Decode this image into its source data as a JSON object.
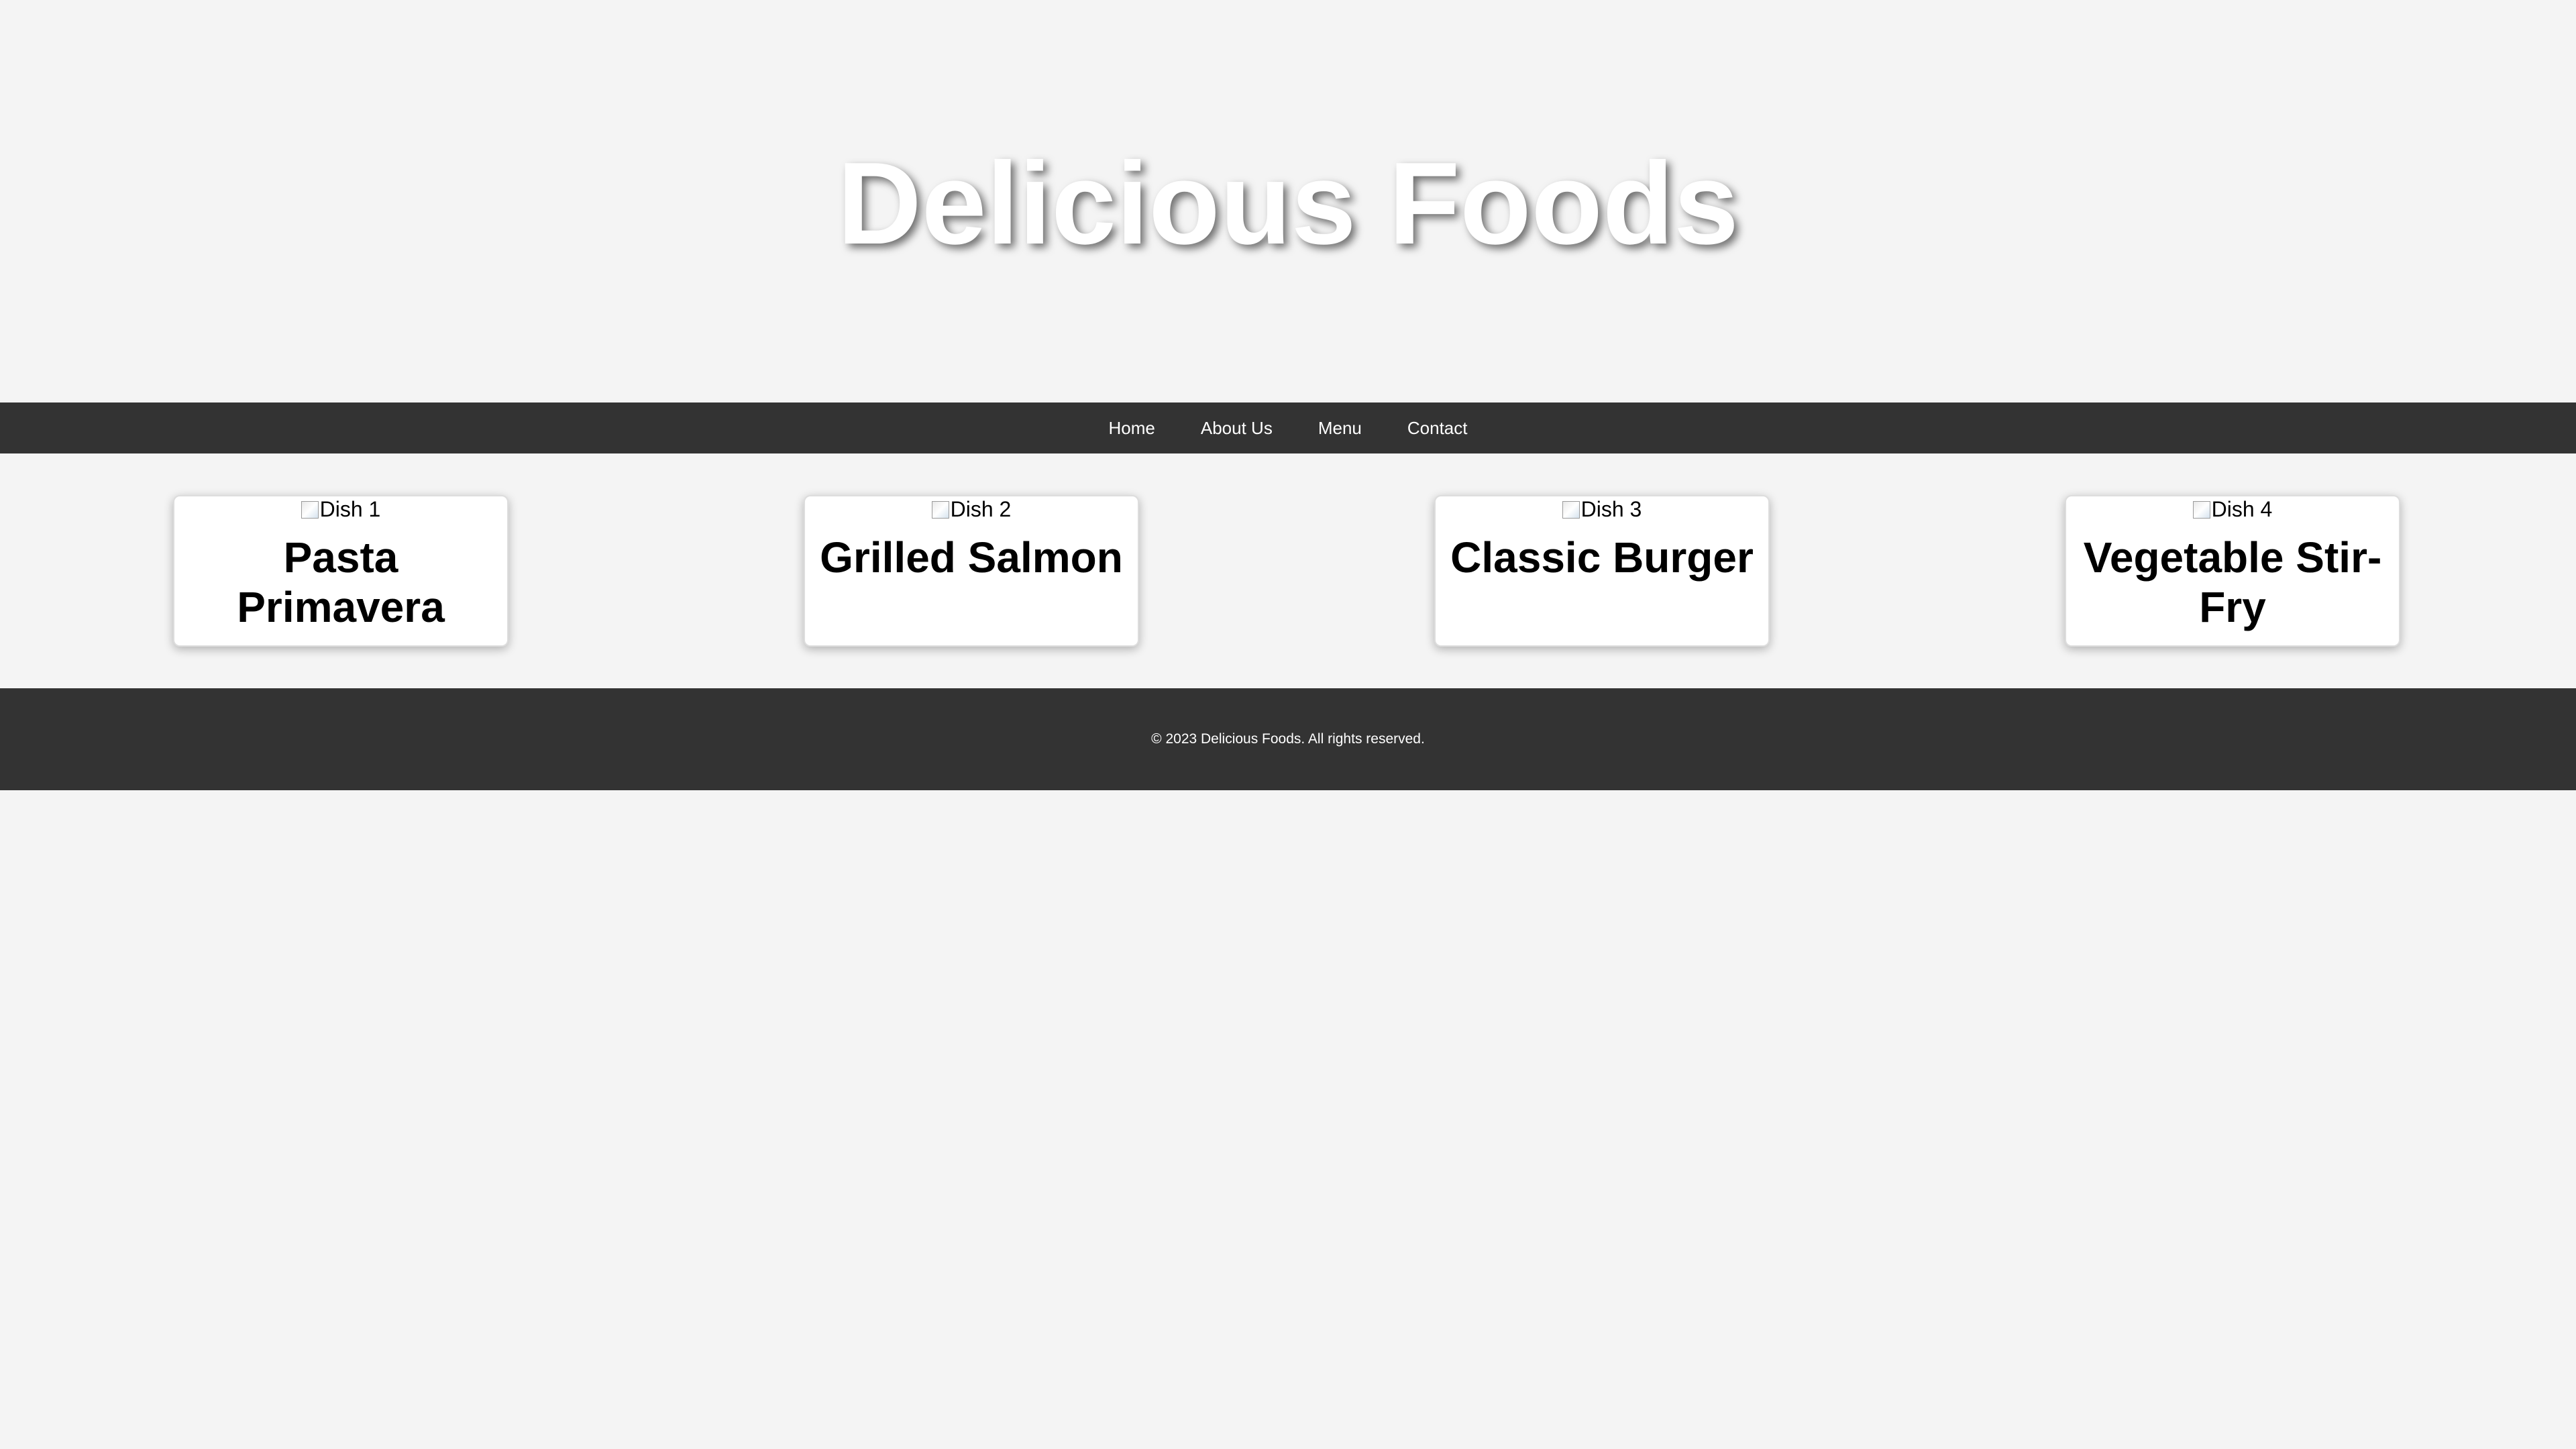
{
  "header": {
    "title": "Delicious Foods"
  },
  "nav": {
    "items": [
      {
        "label": "Home"
      },
      {
        "label": "About Us"
      },
      {
        "label": "Menu"
      },
      {
        "label": "Contact"
      }
    ]
  },
  "dishes": [
    {
      "image_alt": "Dish 1",
      "name": "Pasta Primavera"
    },
    {
      "image_alt": "Dish 2",
      "name": "Grilled Salmon"
    },
    {
      "image_alt": "Dish 3",
      "name": "Classic Burger"
    },
    {
      "image_alt": "Dish 4",
      "name": "Vegetable Stir-Fry"
    }
  ],
  "footer": {
    "text": "© 2023 Delicious Foods. All rights reserved."
  },
  "colors": {
    "background": "#f4f4f4",
    "nav_bg": "#333333",
    "footer_bg": "#333333",
    "card_bg": "#ffffff"
  }
}
